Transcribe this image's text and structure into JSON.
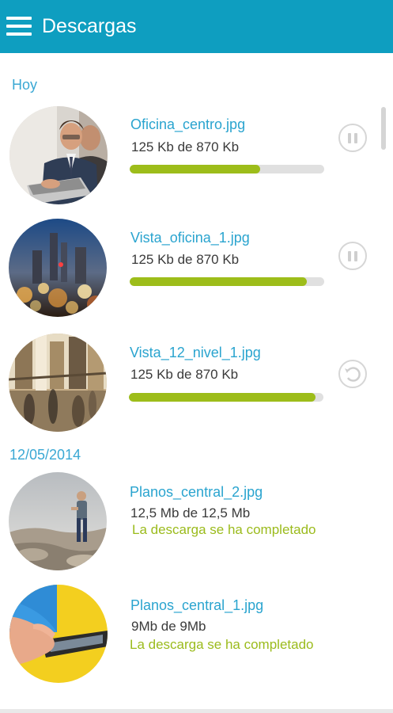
{
  "appbar": {
    "title": "Descargas",
    "menu_icon": "hamburger-menu-icon",
    "color": "#0e9ec0"
  },
  "sections": [
    {
      "header": "Hoy"
    },
    {
      "header": "12/05/2014"
    }
  ],
  "downloads": [
    {
      "filename": "Oficina_centro.jpg",
      "size_text": "125 Kb de 870 Kb",
      "progress": 0.67,
      "action": "pause-icon",
      "thumbnail": "businessman-laptop-photo"
    },
    {
      "filename": "Vista_oficina_1.jpg",
      "size_text": "125 Kb de 870 Kb",
      "progress": 0.91,
      "action": "pause-icon",
      "thumbnail": "city-night-lights-photo"
    },
    {
      "filename": "Vista_12_nivel_1.jpg",
      "size_text": "125 Kb de 870 Kb",
      "progress": 0.96,
      "action": "retry-icon",
      "thumbnail": "street-crowd-photo"
    },
    {
      "filename": "Planos_central_2.jpg",
      "size_text": "12,5 Mb de 12,5 Mb",
      "status": "La descarga se ha completado",
      "thumbnail": "man-on-rocks-photo"
    },
    {
      "filename": "Planos_central_1.jpg",
      "size_text": "9Mb de 9Mb",
      "status": "La descarga se ha completado",
      "thumbnail": "hand-smartphone-photo"
    }
  ],
  "colors": {
    "accent": "#2aa4cf",
    "progress": "#9dbd1a",
    "complete": "#9bbb1c"
  }
}
